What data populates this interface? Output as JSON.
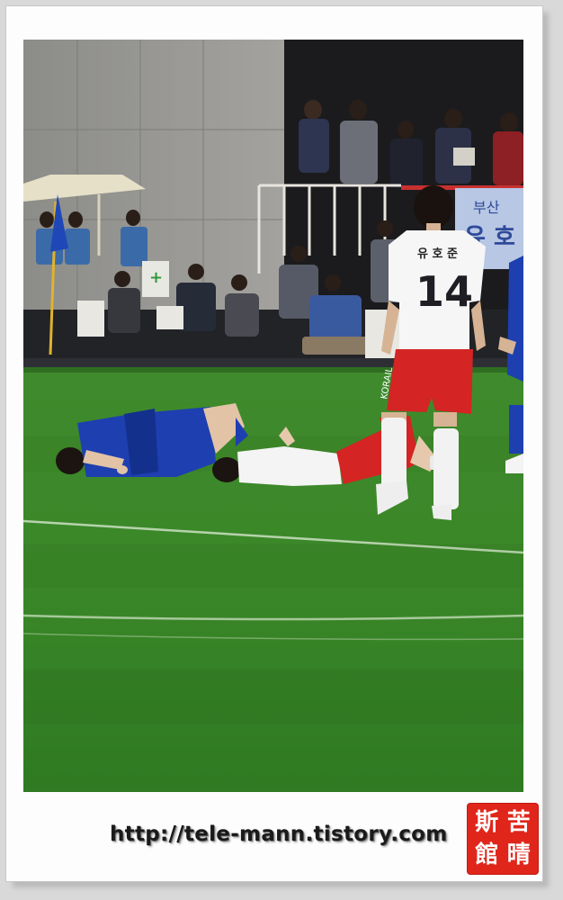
{
  "photo": {
    "description_label": "photo",
    "player_number": "14",
    "player_name_on_shirt": "유 호 준",
    "banner_text_top": "부산",
    "banner_text_bottom": "유 호",
    "shorts_brand": "KORAIL"
  },
  "watermark": {
    "url": "http://tele-mann.tistory.com",
    "seal_chars": [
      "斯",
      "苦",
      "館",
      "晴"
    ]
  },
  "colors": {
    "pitch": "#3f8f2c",
    "blue_kit": "#1e3fb0",
    "red_kit": "#d42424",
    "seal": "#e0261b"
  }
}
